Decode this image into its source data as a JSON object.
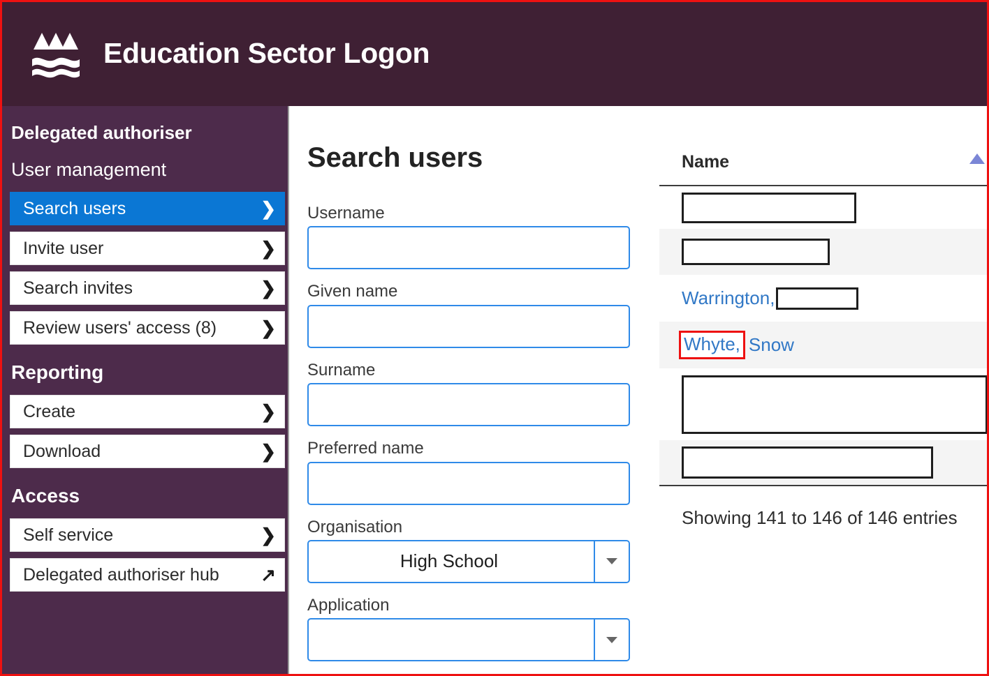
{
  "header": {
    "title": "Education Sector Logon",
    "logo_icon": "mountains-and-waves-icon",
    "background_color": "#3f2034"
  },
  "sidebar": {
    "background_color": "#4d2b4b",
    "active_color": "#0b77d4",
    "role_heading": "Delegated authoriser",
    "groups": [
      {
        "heading": "User management",
        "items": [
          {
            "label": "Search users",
            "active": true,
            "chevron": "chevron-right-icon"
          },
          {
            "label": "Invite user",
            "active": false,
            "chevron": "chevron-right-icon"
          },
          {
            "label": "Search invites",
            "active": false,
            "chevron": "chevron-right-icon"
          },
          {
            "label": "Review users' access (8)",
            "active": false,
            "chevron": "chevron-right-icon"
          }
        ]
      },
      {
        "heading": "Reporting",
        "items": [
          {
            "label": "Create",
            "active": false,
            "chevron": "chevron-right-icon"
          },
          {
            "label": "Download",
            "active": false,
            "chevron": "chevron-right-icon"
          }
        ]
      },
      {
        "heading": "Access",
        "items": [
          {
            "label": "Self service",
            "active": false,
            "chevron": "chevron-right-icon"
          },
          {
            "label": "Delegated authoriser hub",
            "active": false,
            "chevron": "external-link-icon"
          }
        ]
      }
    ]
  },
  "main": {
    "page_title": "Search users",
    "form": {
      "fields": [
        {
          "label": "Username",
          "value": "",
          "type": "text"
        },
        {
          "label": "Given name",
          "value": "",
          "type": "text"
        },
        {
          "label": "Surname",
          "value": "",
          "type": "text"
        },
        {
          "label": "Preferred name",
          "value": "",
          "type": "text"
        },
        {
          "label": "Organisation",
          "value": "High School",
          "type": "select"
        },
        {
          "label": "Application",
          "value": "",
          "type": "select"
        }
      ]
    },
    "results": {
      "column_header": "Name",
      "sort_indicator": "sort-ascending-icon",
      "sort_indicator_color": "#7b86d6",
      "rows": [
        {
          "redacted": true,
          "text": "",
          "redaction_width": 250,
          "redaction_height": 44
        },
        {
          "redacted": true,
          "text": "",
          "redaction_width": 212,
          "redaction_height": 38
        },
        {
          "redacted": true,
          "text": "Warrington,",
          "redaction_width": 118,
          "redaction_height": 32
        },
        {
          "redacted": false,
          "text": "Whyte, Snow",
          "highlight_text": "Whyte,",
          "rest_text": "Snow",
          "annotated": true
        },
        {
          "redacted": true,
          "text": "",
          "redaction_width": 438,
          "redaction_height": 84
        },
        {
          "redacted": true,
          "text": "",
          "redaction_width": 360,
          "redaction_height": 46
        }
      ],
      "showing_entries": "Showing 141 to 146 of 146 entries"
    }
  },
  "annotation": {
    "frame_color": "#ee1111",
    "highlight_color": "#ee1111"
  }
}
